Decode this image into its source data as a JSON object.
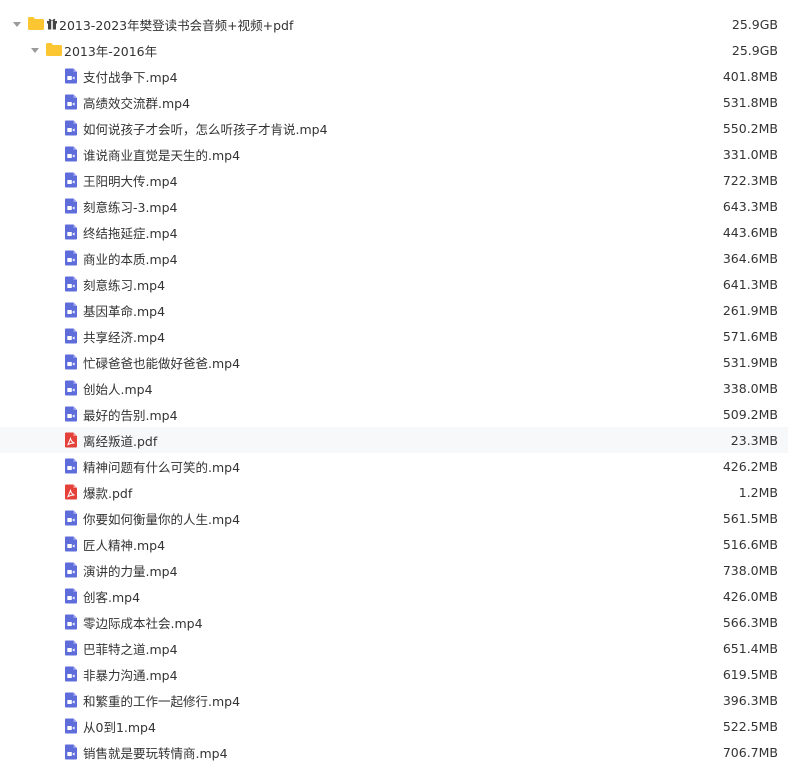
{
  "root": {
    "name": "2013-2023年樊登读书会音频+视频+pdf",
    "size": "25.9GB",
    "icon": "folder-icon",
    "badge_icon": "gift-icon"
  },
  "subfolder": {
    "name": "2013年-2016年",
    "size": "25.9GB",
    "icon": "folder-icon"
  },
  "colors": {
    "folder": "#fbc631",
    "video": "#5f6ddb",
    "pdf": "#e5413b"
  },
  "files": [
    {
      "name": "支付战争下.mp4",
      "size": "401.8MB",
      "type": "video"
    },
    {
      "name": "高绩效交流群.mp4",
      "size": "531.8MB",
      "type": "video"
    },
    {
      "name": "如何说孩子才会听，怎么听孩子才肯说.mp4",
      "size": "550.2MB",
      "type": "video"
    },
    {
      "name": "谁说商业直觉是天生的.mp4",
      "size": "331.0MB",
      "type": "video"
    },
    {
      "name": "王阳明大传.mp4",
      "size": "722.3MB",
      "type": "video"
    },
    {
      "name": "刻意练习-3.mp4",
      "size": "643.3MB",
      "type": "video"
    },
    {
      "name": "终结拖延症.mp4",
      "size": "443.6MB",
      "type": "video"
    },
    {
      "name": "商业的本质.mp4",
      "size": "364.6MB",
      "type": "video"
    },
    {
      "name": "刻意练习.mp4",
      "size": "641.3MB",
      "type": "video"
    },
    {
      "name": "基因革命.mp4",
      "size": "261.9MB",
      "type": "video"
    },
    {
      "name": "共享经济.mp4",
      "size": "571.6MB",
      "type": "video"
    },
    {
      "name": "忙碌爸爸也能做好爸爸.mp4",
      "size": "531.9MB",
      "type": "video"
    },
    {
      "name": "创始人.mp4",
      "size": "338.0MB",
      "type": "video"
    },
    {
      "name": "最好的告别.mp4",
      "size": "509.2MB",
      "type": "video"
    },
    {
      "name": "离经叛道.pdf",
      "size": "23.3MB",
      "type": "pdf",
      "highlighted": true
    },
    {
      "name": "精神问题有什么可笑的.mp4",
      "size": "426.2MB",
      "type": "video"
    },
    {
      "name": "爆款.pdf",
      "size": "1.2MB",
      "type": "pdf"
    },
    {
      "name": "你要如何衡量你的人生.mp4",
      "size": "561.5MB",
      "type": "video"
    },
    {
      "name": "匠人精神.mp4",
      "size": "516.6MB",
      "type": "video"
    },
    {
      "name": "演讲的力量.mp4",
      "size": "738.0MB",
      "type": "video"
    },
    {
      "name": "创客.mp4",
      "size": "426.0MB",
      "type": "video"
    },
    {
      "name": "零边际成本社会.mp4",
      "size": "566.3MB",
      "type": "video"
    },
    {
      "name": "巴菲特之道.mp4",
      "size": "651.4MB",
      "type": "video"
    },
    {
      "name": "非暴力沟通.mp4",
      "size": "619.5MB",
      "type": "video"
    },
    {
      "name": "和繁重的工作一起修行.mp4",
      "size": "396.3MB",
      "type": "video"
    },
    {
      "name": "从0到1.mp4",
      "size": "522.5MB",
      "type": "video"
    },
    {
      "name": "销售就是要玩转情商.mp4",
      "size": "706.7MB",
      "type": "video"
    }
  ]
}
